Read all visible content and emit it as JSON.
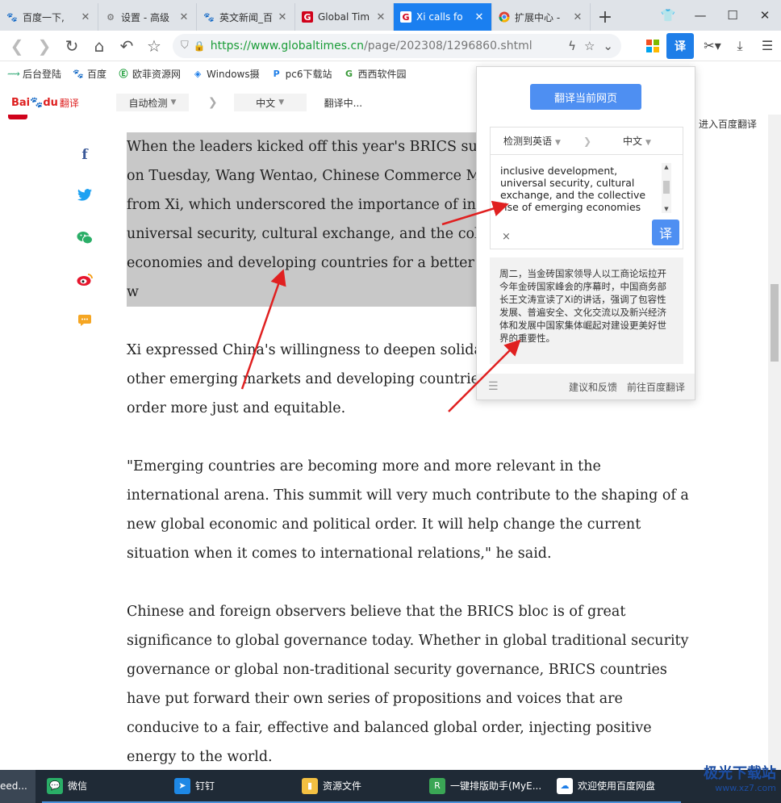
{
  "tabs": [
    {
      "label": "百度一下,",
      "icon": "baidu-paw-icon",
      "active": false
    },
    {
      "label": "设置 - 高级",
      "icon": "gear-icon",
      "active": false
    },
    {
      "label": "英文新闻_百",
      "icon": "baidu-paw-icon",
      "active": false
    },
    {
      "label": "Global Tim",
      "icon": "globaltimes-g-icon",
      "active": false
    },
    {
      "label": "Xi calls fo",
      "icon": "globaltimes-g-icon",
      "active": true
    },
    {
      "label": "扩展中心 -",
      "icon": "chrome-icon",
      "active": false
    }
  ],
  "address": {
    "host": "https://www.globaltimes.cn",
    "path": "/page/202308/1296860.shtml"
  },
  "bookmarks": [
    "后台登陆",
    "百度",
    "欧菲资源网",
    "Windows摄",
    "pc6下载站",
    "西西软件园"
  ],
  "translate_bar": {
    "logo_a": "Bai",
    "logo_b": "du",
    "logo_c": "翻译",
    "source_lang": "自动检测",
    "target_lang": "中文",
    "status": "翻译中...",
    "enter_link": "进入百度翻译"
  },
  "article": {
    "highlighted_lines": [
      "When the leaders kicked off this year's BRICS sur",
      "on Tuesday, Wang Wentao, Chinese Commerce M",
      "from Xi, which underscored the importance of in",
      "universal security, cultural exchange, and the col",
      "economies and developing countries for a better w"
    ],
    "p2": "Xi expressed China's willingness to deepen solida other emerging markets and developing countrie order more just and equitable.",
    "p2_lines": [
      "Xi expressed China's willingness to deepen solida",
      "other emerging markets and developing countrie",
      "order more just and equitable."
    ],
    "p3_lines": [
      "\"Emerging countries are becoming more and more relevant in the",
      "international arena. This summit will very much contribute to the shaping of a",
      "new global economic and political order. It will help change the current",
      "situation when it comes to international relations,\" he said."
    ],
    "p4_lines": [
      "Chinese and foreign observers believe that the BRICS bloc is of great",
      "significance to global governance today. Whether in global traditional security",
      "governance or global non-traditional security governance, BRICS countries",
      "have put forward their own series of propositions and voices that are",
      "conducive to a fair, effective and balanced global order, injecting positive",
      "energy to the world."
    ]
  },
  "popup": {
    "translate_page_button": "翻译当前网页",
    "detected_lang": "检测到英语",
    "target_lang": "中文",
    "source_text": "inclusive development, universal security, cultural exchange, and the collective rise of emerging economies and developing",
    "clear": "×",
    "go_button": "译",
    "result": "周二，当金砖国家领导人以工商论坛拉开今年金砖国家峰会的序幕时，中国商务部长王文涛宣读了Xi的讲话，强调了包容性发展、普遍安全、文化交流以及新兴经济体和发展中国家集体崛起对建设更美好世界的重要性。",
    "feedback": "建议和反馈",
    "goto_baidu": "前往百度翻译"
  },
  "taskbar": [
    {
      "label": "eed...",
      "icon": ""
    },
    {
      "label": "微信",
      "icon": "wechat-icon",
      "color": "#2aae67"
    },
    {
      "label": "钉钉",
      "icon": "dingtalk-icon",
      "color": "#1e88e5"
    },
    {
      "label": "资源文件",
      "icon": "folder-icon",
      "color": "#f3c042"
    },
    {
      "label": "一键排版助手(MyE...",
      "icon": "myeditor-icon",
      "color": "#3aa655"
    },
    {
      "label": "欢迎使用百度网盘",
      "icon": "baidu-netdisk-icon",
      "color": "#ffffff"
    }
  ],
  "watermark": {
    "main": "极光下载站",
    "sub": "www.xz7.com"
  },
  "colors": {
    "accent": "#1a7ff0",
    "popup_button": "#4e8ff2",
    "arrow": "#e02020",
    "url_green": "#1a9c37"
  }
}
